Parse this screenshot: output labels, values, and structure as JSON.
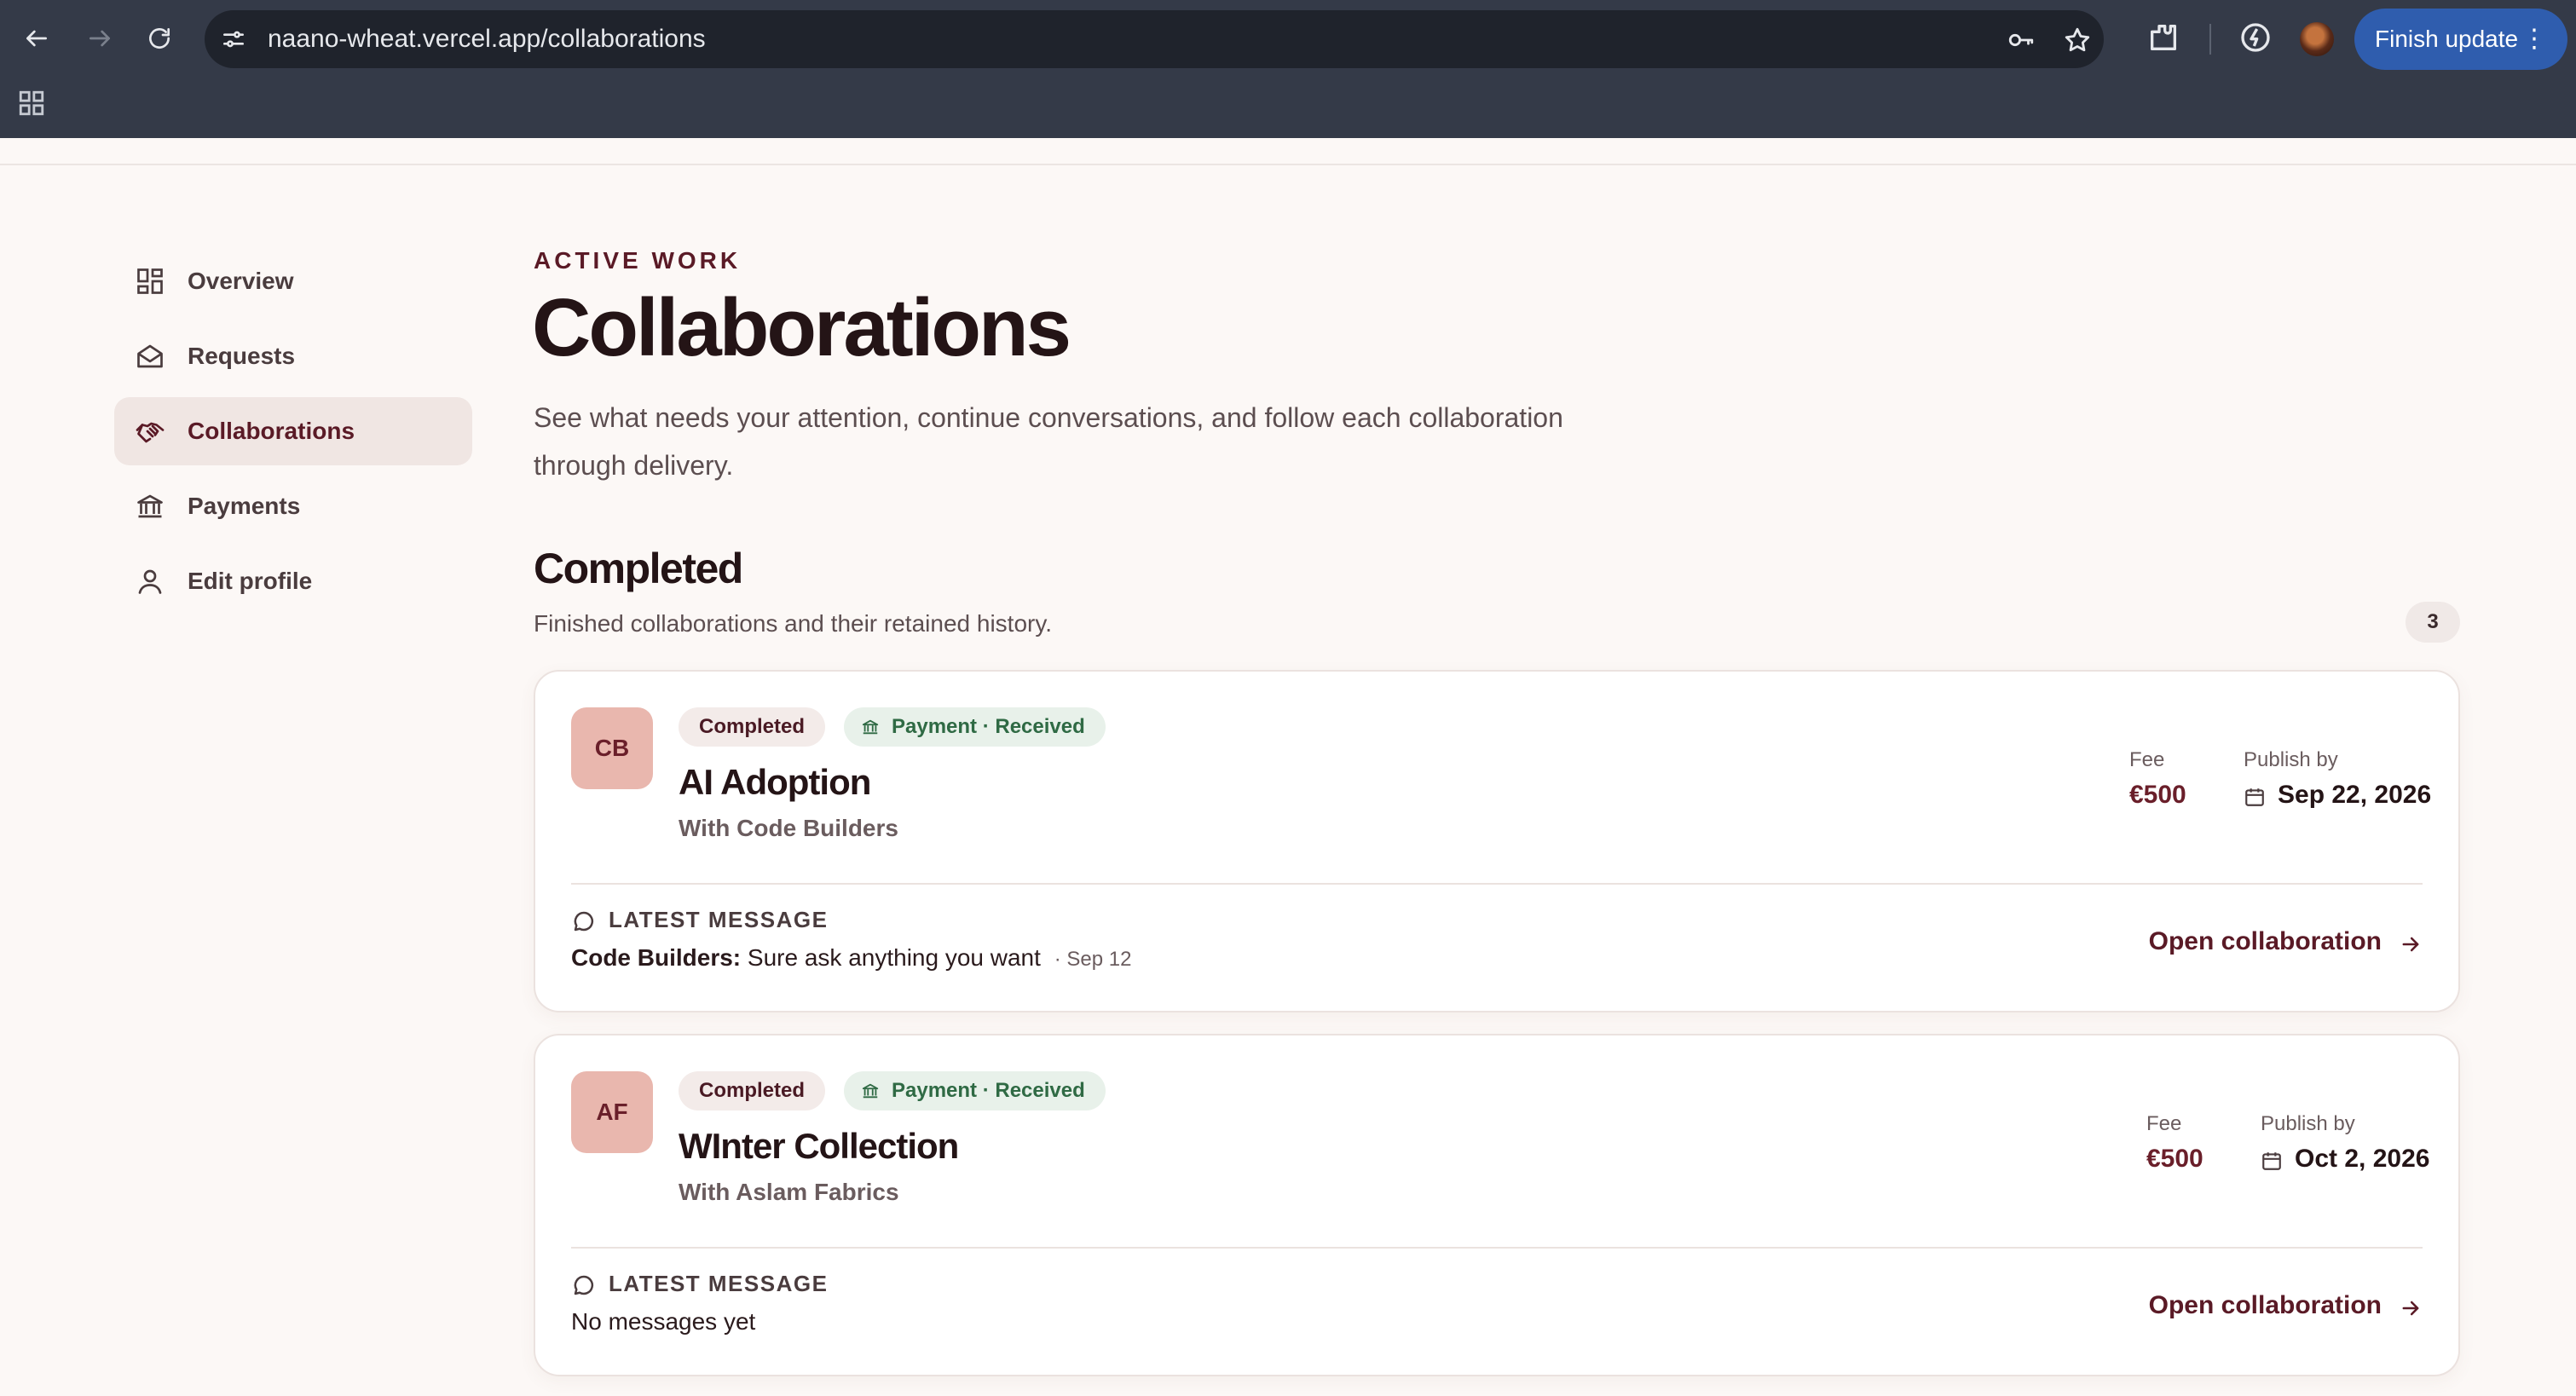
{
  "browser": {
    "url_host": "naano-wheat.vercel.app",
    "url_path": "/collaborations",
    "finish_update_label": "Finish update"
  },
  "sidebar": {
    "items": [
      {
        "label": "Overview",
        "icon": "dashboard-icon",
        "active": false
      },
      {
        "label": "Requests",
        "icon": "envelope-icon",
        "active": false
      },
      {
        "label": "Collaborations",
        "icon": "handshake-icon",
        "active": true
      },
      {
        "label": "Payments",
        "icon": "bank-icon",
        "active": false
      },
      {
        "label": "Edit profile",
        "icon": "user-icon",
        "active": false
      }
    ]
  },
  "header": {
    "eyebrow": "ACTIVE WORK",
    "title": "Collaborations",
    "lead": "See what needs your attention, continue conversations, and follow each collaboration through delivery."
  },
  "section": {
    "title": "Completed",
    "subtitle": "Finished collaborations and their retained history.",
    "count": "3"
  },
  "cards": [
    {
      "initials": "CB",
      "status": "Completed",
      "payment": "Payment · Received",
      "name": "AI Adoption",
      "with": "With Code Builders",
      "fee_label": "Fee",
      "fee": "€500",
      "publish_label": "Publish by",
      "publish_date": "Sep 22, 2026",
      "latest_label": "LATEST MESSAGE",
      "latest_sender": "Code Builders:",
      "latest_text": "Sure ask anything you want",
      "latest_when": "· Sep 12",
      "open_label": "Open collaboration"
    },
    {
      "initials": "AF",
      "status": "Completed",
      "payment": "Payment · Received",
      "name": "WInter Collection",
      "with": "With Aslam Fabrics",
      "fee_label": "Fee",
      "fee": "€500",
      "publish_label": "Publish by",
      "publish_date": "Oct 2, 2026",
      "latest_label": "LATEST MESSAGE",
      "latest_sender": "",
      "latest_text": "No messages yet",
      "latest_when": "",
      "open_label": "Open collaboration"
    }
  ],
  "colors": {
    "accent": "#5a1a26",
    "page_bg": "#fcf8f6",
    "chrome_bg": "#343a48",
    "monogram_bg": "#e9b7ae",
    "payment_green": "#2f6a44",
    "finish_blue": "#2f5dae"
  }
}
